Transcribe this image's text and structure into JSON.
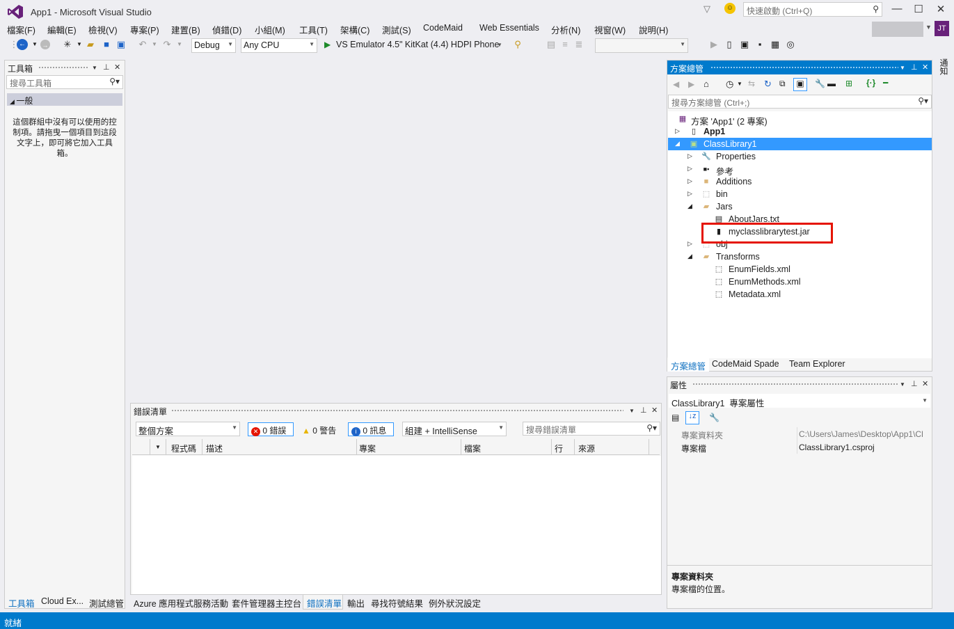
{
  "window": {
    "title": "App1 - Microsoft Visual Studio",
    "quick_launch_placeholder": "快速啟動 (Ctrl+Q)",
    "user_initials": "JT"
  },
  "menu": [
    "檔案(F)",
    "編輯(E)",
    "檢視(V)",
    "專案(P)",
    "建置(B)",
    "偵錯(D)",
    "小組(M)",
    "工具(T)",
    "架構(C)",
    "測試(S)",
    "CodeMaid",
    "Web Essentials",
    "分析(N)",
    "視窗(W)",
    "說明(H)"
  ],
  "toolbar": {
    "config": "Debug",
    "platform": "Any CPU",
    "run_target": "VS Emulator 4.5\" KitKat (4.4) HDPI Phone"
  },
  "toolbox": {
    "title": "工具箱",
    "search_placeholder": "搜尋工具箱",
    "group": "一般",
    "empty_message": "這個群組中沒有可以使用的控制項。請拖曳一個項目到這段文字上，即可將它加入工具箱。"
  },
  "error_list": {
    "title": "錯誤清單",
    "scope": "整個方案",
    "errors": "0 錯誤",
    "warnings": "0 警告",
    "messages": "0 訊息",
    "source_filter": "組建 + IntelliSense",
    "search_placeholder": "搜尋錯誤清單",
    "columns": [
      "程式碼",
      "描述",
      "專案",
      "檔案",
      "行",
      "來源"
    ]
  },
  "bottom_tabs": [
    "工具箱",
    "Cloud Ex...",
    "測試總管",
    "Azure 應用程式服務活動",
    "套件管理器主控台",
    "錯誤清單",
    "輸出",
    "尋找符號結果",
    "例外狀況設定"
  ],
  "solution_explorer": {
    "title": "方案總管",
    "search_placeholder": "搜尋方案總管 (Ctrl+;)",
    "nodes": [
      {
        "label": "方案 'App1' (2 專案)",
        "icon": "solution-icon"
      },
      {
        "label": "App1",
        "icon": "phone-project-icon"
      },
      {
        "label": "ClassLibrary1",
        "icon": "library-project-icon"
      },
      {
        "label": "Properties",
        "icon": "wrench-icon"
      },
      {
        "label": "參考",
        "icon": "references-icon"
      },
      {
        "label": "Additions",
        "icon": "folder-icon"
      },
      {
        "label": "bin",
        "icon": "dashed-folder-icon"
      },
      {
        "label": "Jars",
        "icon": "open-folder-icon"
      },
      {
        "label": "AboutJars.txt",
        "icon": "text-file-icon"
      },
      {
        "label": "myclasslibrarytest.jar",
        "icon": "jar-file-icon"
      },
      {
        "label": "obj",
        "icon": "dashed-folder-icon"
      },
      {
        "label": "Transforms",
        "icon": "open-folder-icon"
      },
      {
        "label": "EnumFields.xml",
        "icon": "xml-file-icon"
      },
      {
        "label": "EnumMethods.xml",
        "icon": "xml-file-icon"
      },
      {
        "label": "Metadata.xml",
        "icon": "xml-file-icon"
      }
    ],
    "tabs": [
      "方案總管",
      "CodeMaid Spade",
      "Team Explorer"
    ]
  },
  "properties": {
    "title": "屬性",
    "target": "ClassLibrary1  專案屬性",
    "rows": [
      {
        "name": "專案資料夾",
        "value": "C:\\Users\\James\\Desktop\\App1\\Cl"
      },
      {
        "name": "專案檔",
        "value": "ClassLibrary1.csproj"
      }
    ],
    "desc_title": "專案資料夾",
    "desc_text": "專案檔的位置。"
  },
  "right_tab": "通知",
  "status": "就緒"
}
